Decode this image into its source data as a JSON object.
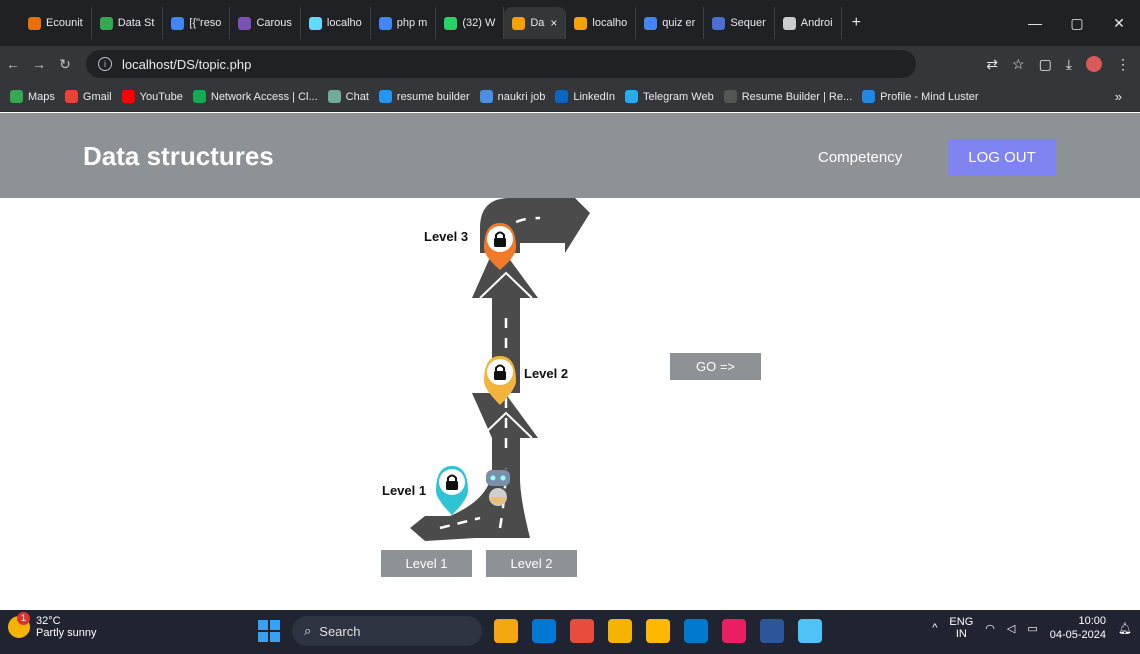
{
  "browser": {
    "tabs": [
      {
        "label": "Ecounit",
        "color": "#e8710a"
      },
      {
        "label": "Data St",
        "color": "#34a853"
      },
      {
        "label": "[{\"reso",
        "color": "#4285f4"
      },
      {
        "label": "Carous",
        "color": "#7952b3"
      },
      {
        "label": "localho",
        "color": "#61dafb"
      },
      {
        "label": "php m",
        "color": "#4285f4"
      },
      {
        "label": "(32) W",
        "color": "#25d366"
      },
      {
        "label": "Da",
        "color": "#f4a300",
        "active": true
      },
      {
        "label": "localho",
        "color": "#f4a300"
      },
      {
        "label": "quiz er",
        "color": "#4285f4"
      },
      {
        "label": "Sequer",
        "color": "#4a6fd1"
      },
      {
        "label": "Androi",
        "color": "#cccccc"
      }
    ],
    "new_tab": "+",
    "close": "×",
    "window_controls": [
      "—",
      "▢",
      "✕"
    ],
    "url": "localhost/DS/topic.php",
    "bookmarks": [
      {
        "label": "Maps",
        "color": "#34a853"
      },
      {
        "label": "Gmail",
        "color": "#ea4335"
      },
      {
        "label": "YouTube",
        "color": "#ff0000"
      },
      {
        "label": "Network Access | Cl...",
        "color": "#13aa52"
      },
      {
        "label": "Chat",
        "color": "#74aa9c"
      },
      {
        "label": "resume builder",
        "color": "#2196f3"
      },
      {
        "label": "naukri job",
        "color": "#4a90e2"
      },
      {
        "label": "LinkedIn",
        "color": "#0a66c2"
      },
      {
        "label": "Telegram Web",
        "color": "#2aabee"
      },
      {
        "label": "Resume Builder | Re...",
        "color": "#555555"
      },
      {
        "label": "Profile - Mind Luster",
        "color": "#1e88e5"
      }
    ],
    "bookmarks_more": "»"
  },
  "site": {
    "title": "Data structures",
    "nav_competency": "Competency",
    "logout": "LOG OUT",
    "header_bg": "#8d9297",
    "logout_bg": "#7f84f2"
  },
  "map": {
    "level1_label": "Level 1",
    "level2_label": "Level 2",
    "level3_label": "Level 3",
    "pin_colors": {
      "level1": "#2ec4d6",
      "level2": "#f2b43a",
      "level3": "#f07a2a"
    },
    "go_button": "GO =>",
    "level_buttons": [
      "Level 1",
      "Level 2"
    ]
  },
  "taskbar": {
    "temperature": "32°C",
    "weather": "Partly sunny",
    "notification_count": "1",
    "search_placeholder": "Search",
    "lang": "ENG",
    "region": "IN",
    "time": "10:00",
    "date": "04-05-2024",
    "apps": [
      "#f3a712",
      "#0078d4",
      "#e74c3c",
      "#f4b400",
      "#ffb900",
      "#007acc",
      "#e91e63",
      "#2b579a",
      "#4fc3f7"
    ]
  }
}
